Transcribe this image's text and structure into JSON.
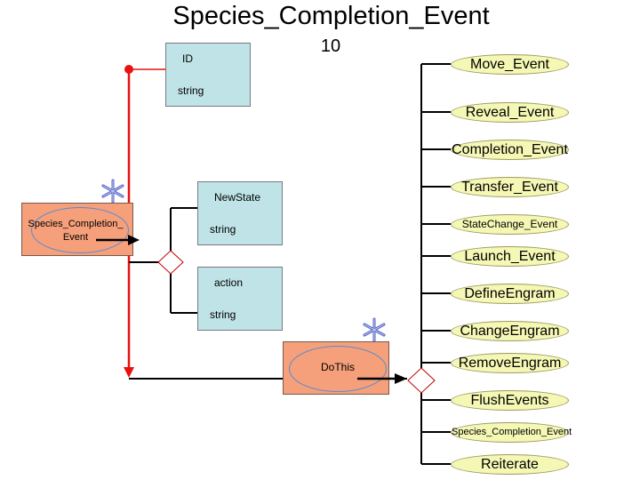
{
  "diagram": {
    "title": "Species_Completion_Event",
    "number": "10",
    "id_box": {
      "name": "ID",
      "type": "string"
    },
    "newstate_box": {
      "name": "NewState",
      "type": "string"
    },
    "action_box": {
      "name": "action",
      "type": "string"
    },
    "main_node": {
      "label": "Species_Completion_\nEvent"
    },
    "dothis_node": {
      "label": "DoThis"
    },
    "events": [
      "Move_Event",
      "Reveal_Event",
      "Completion_Event",
      "Transfer_Event",
      "StateChange_Event",
      "Launch_Event",
      "DefineEngram",
      "ChangeEngram",
      "RemoveEngram",
      "FlushEvents",
      "Species_Completion_Event",
      "Reiterate"
    ],
    "colors": {
      "attribute_box": "#bfe3e6",
      "node": "#f5a07a",
      "event": "#f5f7b5",
      "relation_line": "#e81010"
    },
    "icons": [
      "asterisk-icon",
      "asterisk-icon"
    ]
  }
}
